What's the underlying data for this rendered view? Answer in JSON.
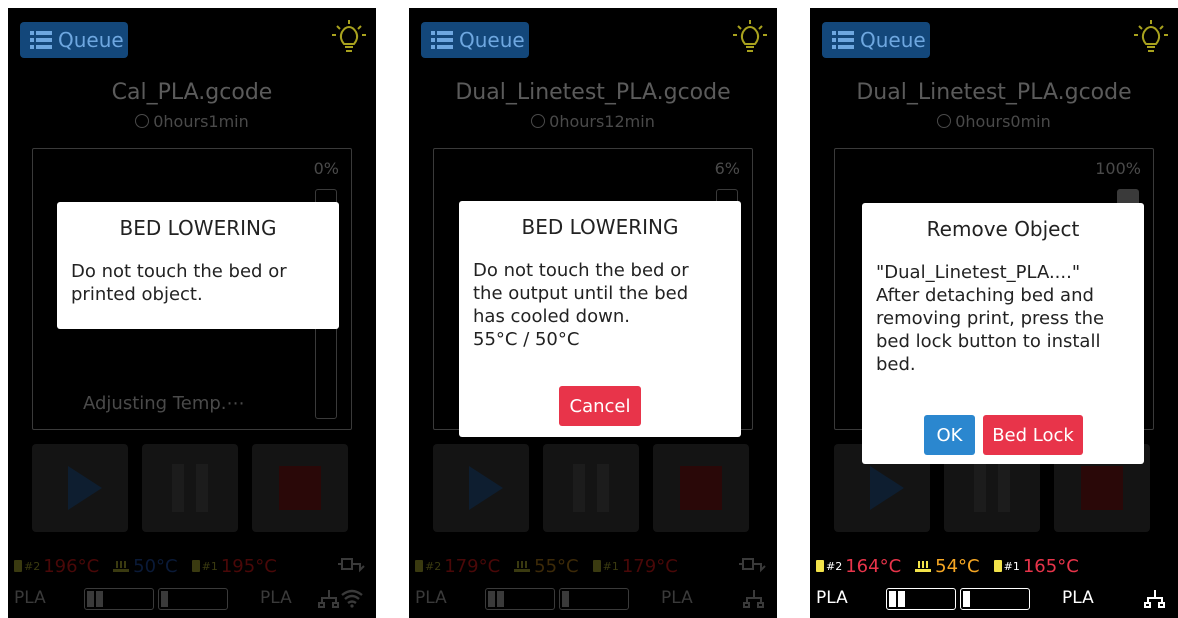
{
  "colors": {
    "nozzle_red": "#c01818",
    "bed_blue": "#2e6ec0",
    "temp_orange": "#f5a623",
    "danger": "#e8344a",
    "primary": "#2b87cf",
    "queue_bg": "#13477a"
  },
  "screens": [
    {
      "queue_label": "Queue",
      "file_name": "Cal_PLA.gcode",
      "print_time": "0hours1min",
      "progress_text": "0%",
      "progress": 0,
      "status_line": "Adjusting Temp.⋯",
      "nozzle2_label": "#2",
      "nozzle2_temp": "196°C",
      "bed_temp": "50°C",
      "nozzle1_label": "#1",
      "nozzle1_temp": "195°C",
      "filament_left": "PLA",
      "filament_right": "PLA",
      "modal": {
        "title": "BED LOWERING",
        "body": "Do not touch the bed or\nprinted object."
      }
    },
    {
      "queue_label": "Queue",
      "file_name": "Dual_Linetest_PLA.gcode",
      "print_time": "0hours12min",
      "progress_text": "6%",
      "progress": 0.06,
      "nozzle2_label": "#2",
      "nozzle2_temp": "179°C",
      "bed_temp": "55°C",
      "nozzle1_label": "#1",
      "nozzle1_temp": "179°C",
      "filament_left": "PLA",
      "filament_right": "PLA",
      "modal": {
        "title": "BED LOWERING",
        "body": "Do not touch the bed or\nthe output until the bed\nhas cooled down.\n55°C / 50°C",
        "cancel_label": "Cancel"
      }
    },
    {
      "queue_label": "Queue",
      "file_name": "Dual_Linetest_PLA.gcode",
      "print_time": "0hours0min",
      "progress_text": "100%",
      "progress": 1.0,
      "nozzle2_label": "#2",
      "nozzle2_temp": "164°C",
      "bed_temp": "54°C",
      "nozzle1_label": "#1",
      "nozzle1_temp": "165°C",
      "filament_left": "PLA",
      "filament_right": "PLA",
      "modal": {
        "title": "Remove Object",
        "body": "\"Dual_Linetest_PLA....\"\nAfter detaching bed and\nremoving print, press the\nbed lock button to install\nbed.",
        "ok_label": "OK",
        "bedlock_label": "Bed Lock"
      }
    }
  ],
  "icons": [
    "list-icon",
    "lightbulb-icon",
    "clock-icon",
    "play-icon",
    "pause-icon",
    "stop-icon",
    "nozzle-icon",
    "heated-bed-icon",
    "usb-plug-icon",
    "network-icon",
    "wifi-icon",
    "filament-spool-icon"
  ]
}
